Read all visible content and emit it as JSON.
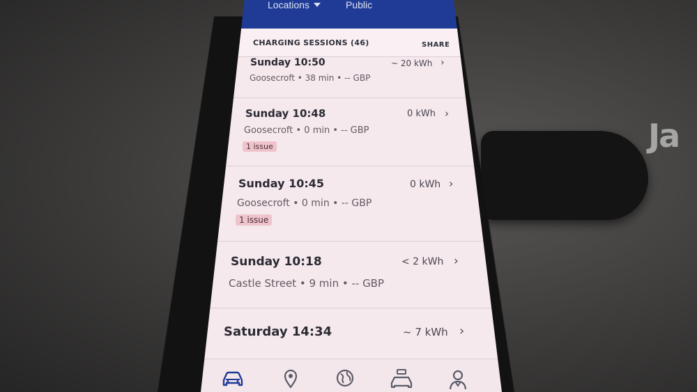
{
  "desk": {
    "logo_text": "Ja"
  },
  "topbar": {
    "locations_label": "Locations",
    "public_label": "Public"
  },
  "section": {
    "title": "CHARGING SESSIONS (46)",
    "share_label": "SHARE"
  },
  "sessions": [
    {
      "time": "Sunday 10:50",
      "energy": "~ 20 kWh",
      "meta": "Goosecroft • 38 min • -- GBP"
    },
    {
      "time": "Sunday 10:48",
      "energy": "0 kWh",
      "meta": "Goosecroft • 0 min • -- GBP",
      "issue": "1 issue"
    },
    {
      "time": "Sunday 10:45",
      "energy": "0 kWh",
      "meta": "Goosecroft • 0 min • -- GBP",
      "issue": "1 issue"
    },
    {
      "time": "Sunday 10:18",
      "energy": "< 2 kWh",
      "meta": "Castle Street • 9 min • -- GBP"
    },
    {
      "time": "Saturday 14:34",
      "energy": "~ 7 kWh"
    }
  ],
  "chevron": "›",
  "nav": {
    "items": [
      "car-icon",
      "map-pin-icon",
      "globe-icon",
      "car-fleet-icon",
      "profile-icon"
    ],
    "active_color": "#1f3b96",
    "inactive_color": "#5a5a66"
  }
}
